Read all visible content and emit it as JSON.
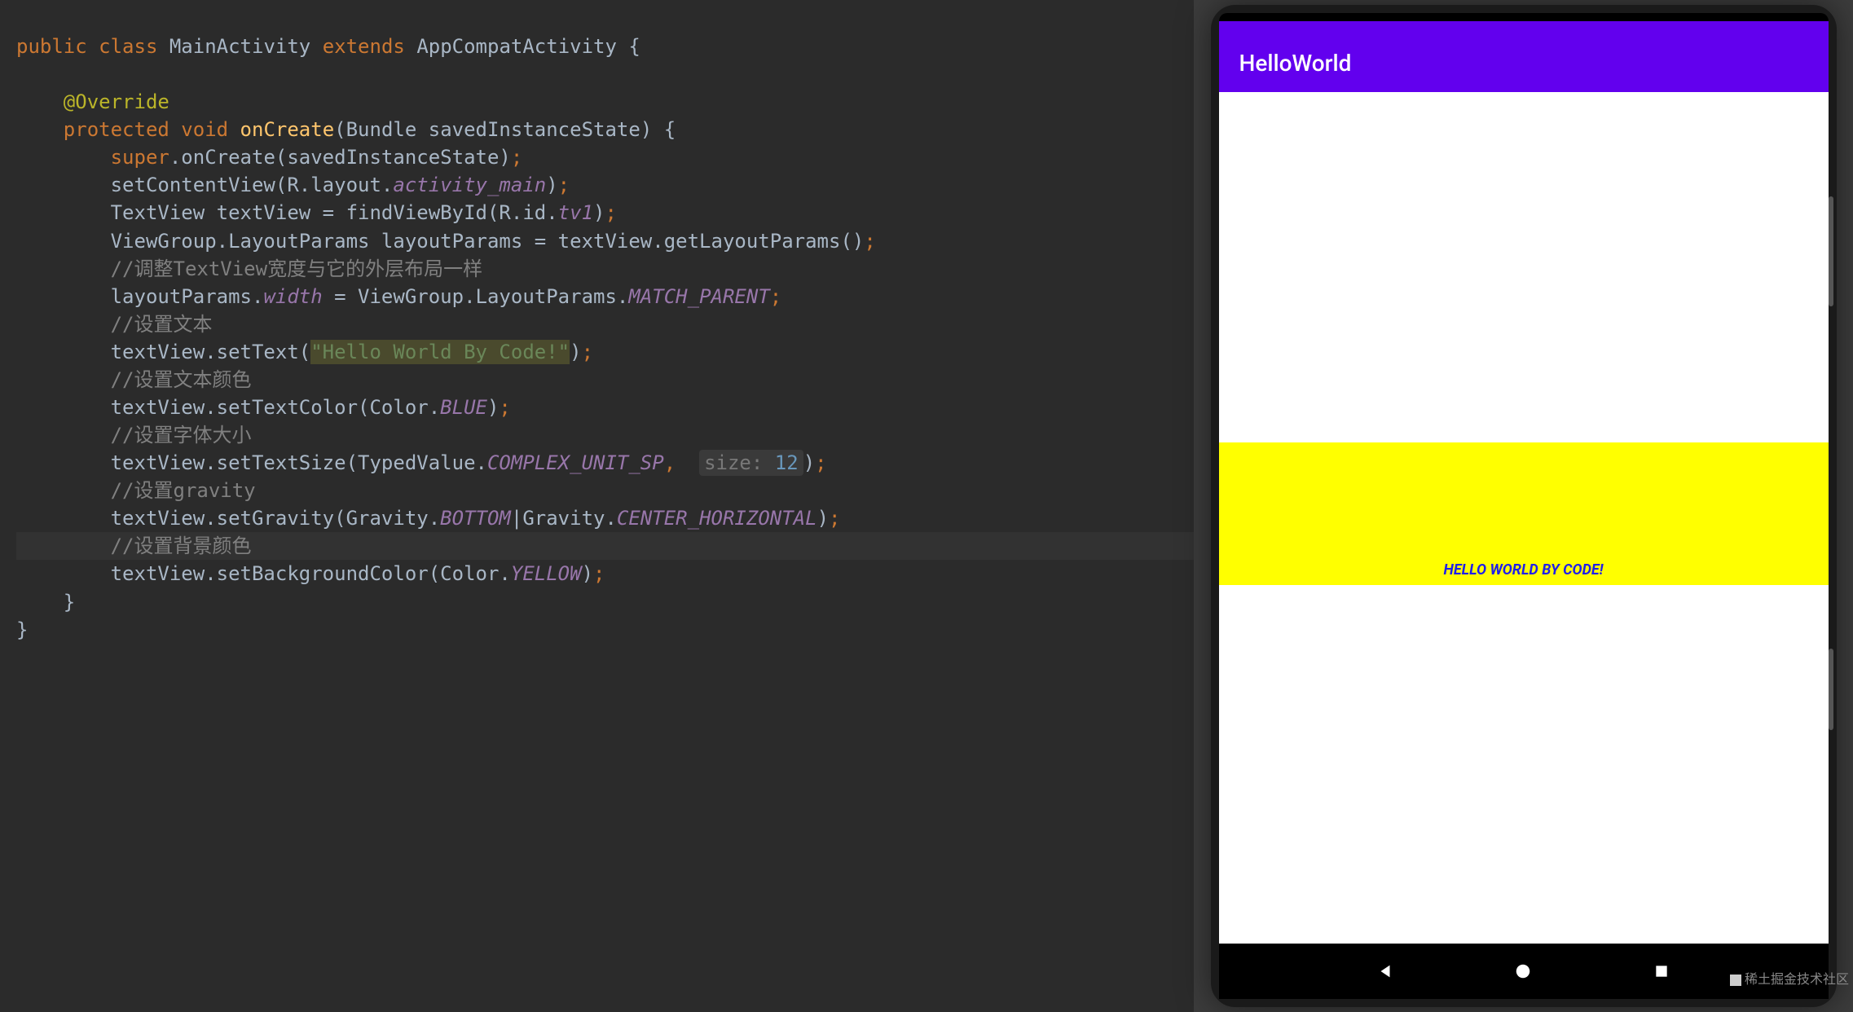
{
  "code": {
    "kw_public": "public",
    "kw_class": "class",
    "cls_main": "MainActivity",
    "kw_extends": "extends",
    "cls_appcompat": "AppCompatActivity",
    "ann_override": "@Override",
    "kw_protected": "protected",
    "kw_void": "void",
    "m_oncreate": "onCreate",
    "p_bundle": "Bundle savedInstanceState",
    "l_super": "super",
    "l_super_call": ".onCreate(savedInstanceState)",
    "l_setcontent": "setContentView(R.layout.",
    "f_activity": "activity_main",
    "l_textview": "TextView textView = findViewById(R.id.",
    "f_tv1": "tv1",
    "l_viewgroup": "ViewGroup.LayoutParams layoutParams = textView.getLayoutParams()",
    "c_adjust": "//调整TextView宽度与它的外层布局一样",
    "l_width_a": "layoutParams.",
    "f_width": "width",
    "l_width_b": " = ViewGroup.LayoutParams.",
    "f_matchparent": "MATCH_PARENT",
    "c_settext": "//设置文本",
    "l_settext": "textView.setText(",
    "s_hello": "\"Hello World By Code!\"",
    "c_textcolor": "//设置文本颜色",
    "l_textcolor": "textView.setTextColor(Color.",
    "f_blue": "BLUE",
    "c_textsize": "//设置字体大小",
    "l_textsize": "textView.setTextSize(TypedValue.",
    "f_complexsp": "COMPLEX_UNIT_SP",
    "h_size": "size:",
    "n_12": "12",
    "c_gravity": "//设置gravity",
    "l_gravity_a": "textView.setGravity(Gravity.",
    "f_bottom": "BOTTOM",
    "l_gravity_b": "|Gravity.",
    "f_centerh": "CENTER_HORIZONTAL",
    "c_bgcolor": "//设置背景颜色",
    "l_bgcolor": "textView.setBackgroundColor(Color.",
    "f_yellow": "YELLOW"
  },
  "app": {
    "title": "HelloWorld",
    "tv_text": "HELLO WORLD BY CODE!"
  },
  "watermark": "稀土掘金技术社区"
}
